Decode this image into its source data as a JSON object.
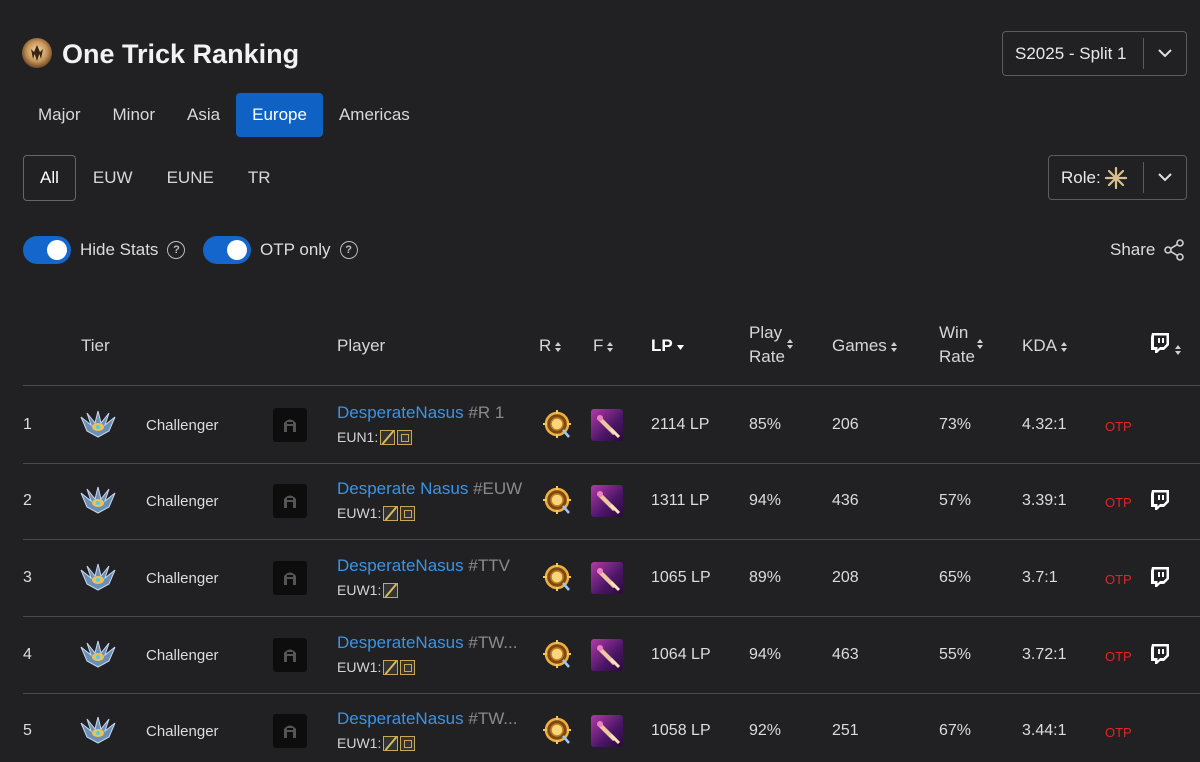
{
  "header": {
    "title": "One Trick Ranking",
    "season": "S2025 - Split 1"
  },
  "region_tabs": [
    "Major",
    "Minor",
    "Asia",
    "Europe",
    "Americas"
  ],
  "active_region": "Europe",
  "server_tabs": [
    "All",
    "EUW",
    "EUNE",
    "TR"
  ],
  "active_server": "All",
  "role_filter": {
    "label": "Role:"
  },
  "toggles": {
    "hide_stats": {
      "label": "Hide Stats",
      "on": true
    },
    "otp_only": {
      "label": "OTP only",
      "on": true
    }
  },
  "share_label": "Share",
  "table": {
    "headers": {
      "tier": "Tier",
      "player": "Player",
      "r": "R",
      "f": "F",
      "lp": "LP",
      "play_rate_1": "Play",
      "play_rate_2": "Rate",
      "games": "Games",
      "win_rate_1": "Win",
      "win_rate_2": "Rate",
      "kda": "KDA"
    },
    "rows": [
      {
        "rank": "1",
        "tier": "Challenger",
        "name": "DesperateNasus",
        "tag": "#R 1",
        "server": "EUN1:",
        "items": 2,
        "lp": "2114 LP",
        "play_rate": "85%",
        "games": "206",
        "win_rate": "73%",
        "kda": "4.32:1",
        "otp": "OTP",
        "twitch": false
      },
      {
        "rank": "2",
        "tier": "Challenger",
        "name": "Desperate Nasus",
        "tag": "#EUW",
        "server": "EUW1:",
        "items": 2,
        "lp": "1311 LP",
        "play_rate": "94%",
        "games": "436",
        "win_rate": "57%",
        "kda": "3.39:1",
        "otp": "OTP",
        "twitch": true
      },
      {
        "rank": "3",
        "tier": "Challenger",
        "name": "DesperateNasus",
        "tag": "#TTV",
        "server": "EUW1:",
        "items": 1,
        "lp": "1065 LP",
        "play_rate": "89%",
        "games": "208",
        "win_rate": "65%",
        "kda": "3.7:1",
        "otp": "OTP",
        "twitch": true
      },
      {
        "rank": "4",
        "tier": "Challenger",
        "name": "DesperateNasus",
        "tag": "#TW...",
        "server": "EUW1:",
        "items": 2,
        "lp": "1064 LP",
        "play_rate": "94%",
        "games": "463",
        "win_rate": "55%",
        "kda": "3.72:1",
        "otp": "OTP",
        "twitch": true
      },
      {
        "rank": "5",
        "tier": "Challenger",
        "name": "DesperateNasus",
        "tag": "#TW...",
        "server": "EUW1:",
        "items": 2,
        "lp": "1058 LP",
        "play_rate": "92%",
        "games": "251",
        "win_rate": "67%",
        "kda": "3.44:1",
        "otp": "OTP",
        "twitch": false
      }
    ]
  },
  "colors": {
    "background": "#212124",
    "accent": "#0f62c4",
    "link": "#3a94e6",
    "otp": "#e32424",
    "divider": "#4b4b4f"
  },
  "icons": [
    "logo-icon",
    "chevron-down-icon",
    "role-all-icon",
    "help-icon",
    "share-icon",
    "sort-icon",
    "twitch-icon",
    "challenger-icon",
    "champion-icon",
    "rune-icon",
    "summoner-spell-icon"
  ]
}
